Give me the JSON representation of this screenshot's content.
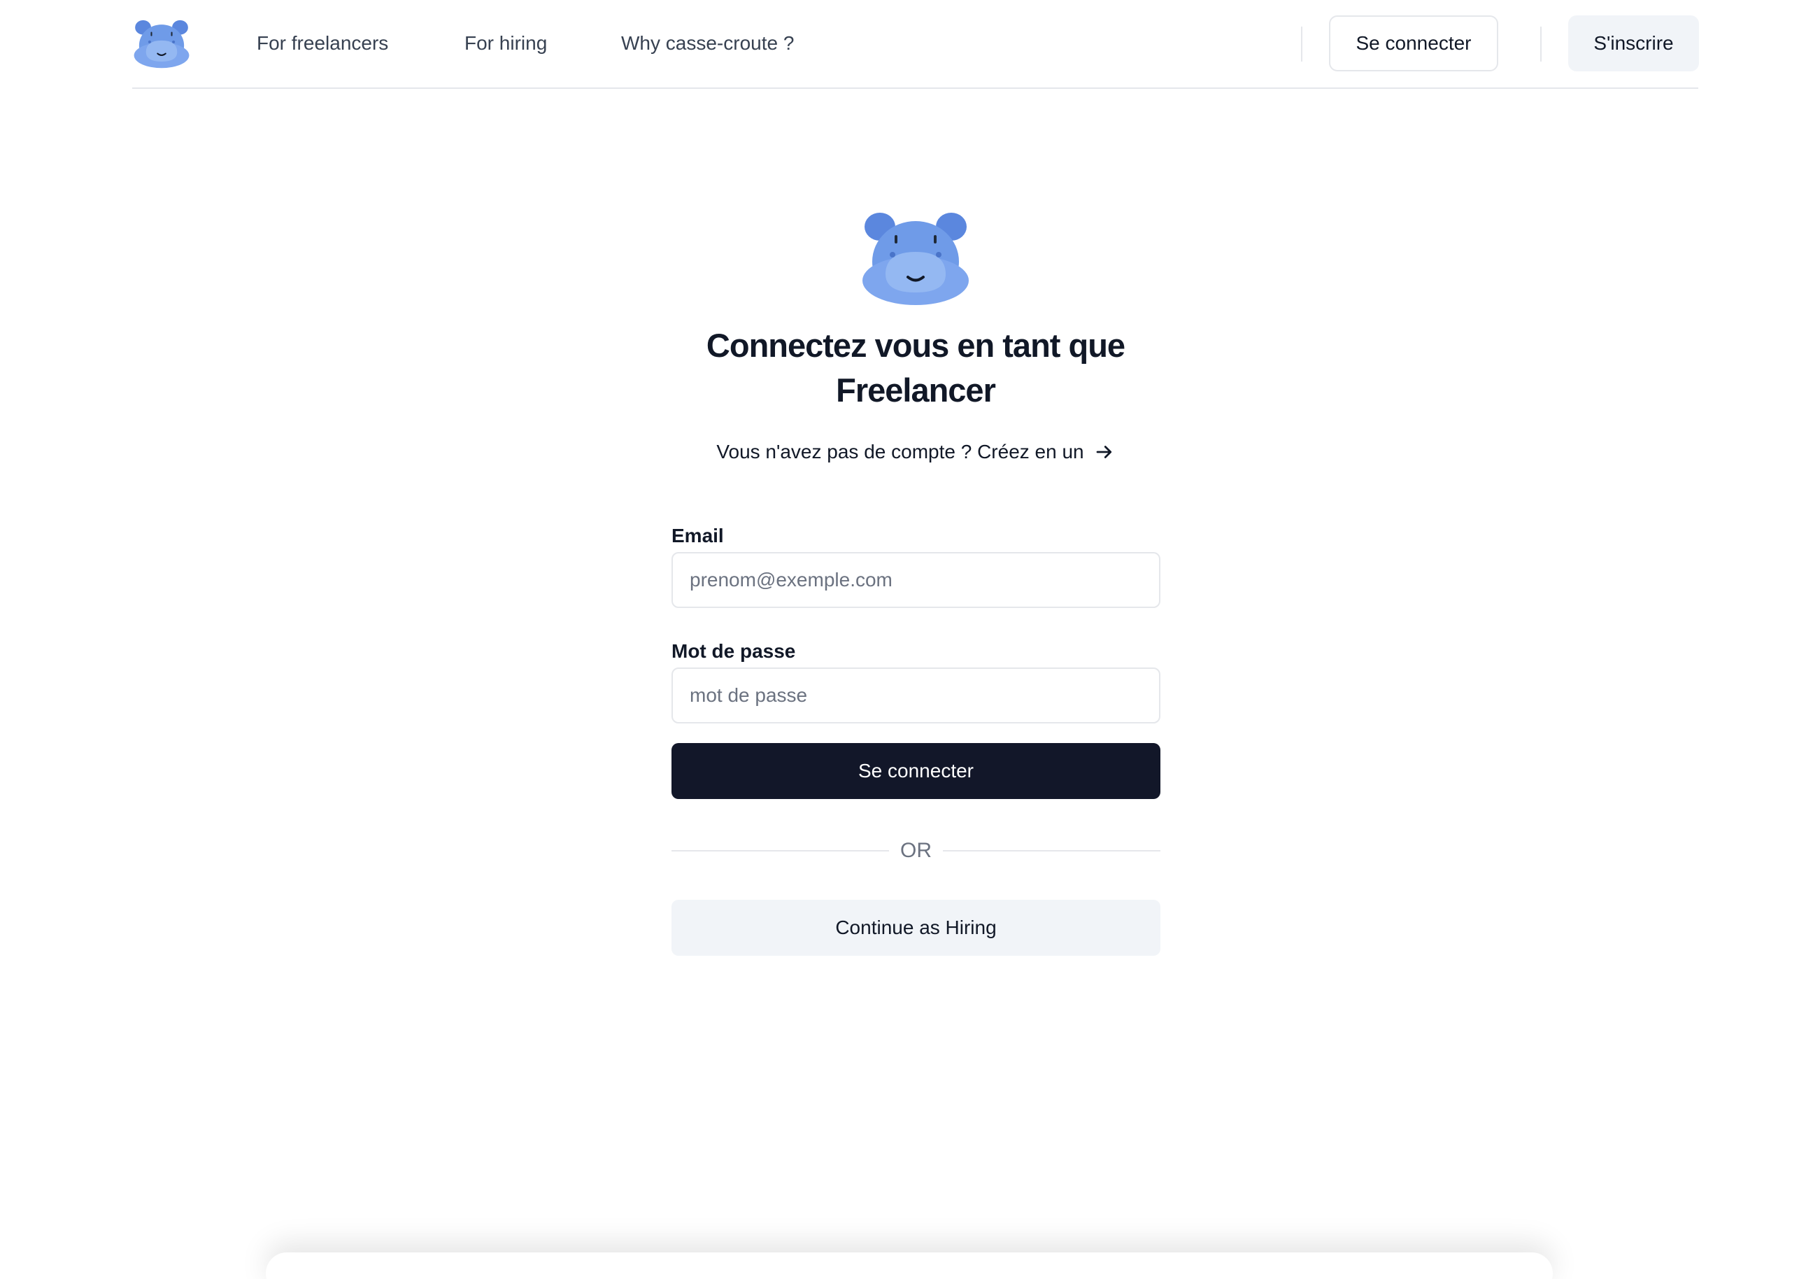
{
  "nav": {
    "logo_icon": "hippo-logo-icon",
    "links": [
      "For freelancers",
      "For hiring",
      "Why casse-croute ?"
    ],
    "login_button": "Se connecter",
    "signup_button": "S'inscrire"
  },
  "main": {
    "logo_icon": "hippo-logo-icon",
    "title_line1": "Connectez vous en tant que",
    "title_line2": "Freelancer",
    "signup_prompt": "Vous n'avez pas de compte ? Créez en un",
    "signup_arrow_icon": "arrow-right-icon",
    "email_label": "Email",
    "email_placeholder": "prenom@exemple.com",
    "email_value": "",
    "password_label": "Mot de passe",
    "password_placeholder": "mot de passe",
    "password_value": "",
    "submit_button": "Se connecter",
    "divider_text": "OR",
    "alt_button": "Continue as Hiring"
  },
  "colors": {
    "primary_button": "#121729",
    "secondary_button": "#f1f4f8",
    "hippo_body": "#6f9be8",
    "hippo_snout": "#94b8f2",
    "border": "#e5e7eb"
  }
}
